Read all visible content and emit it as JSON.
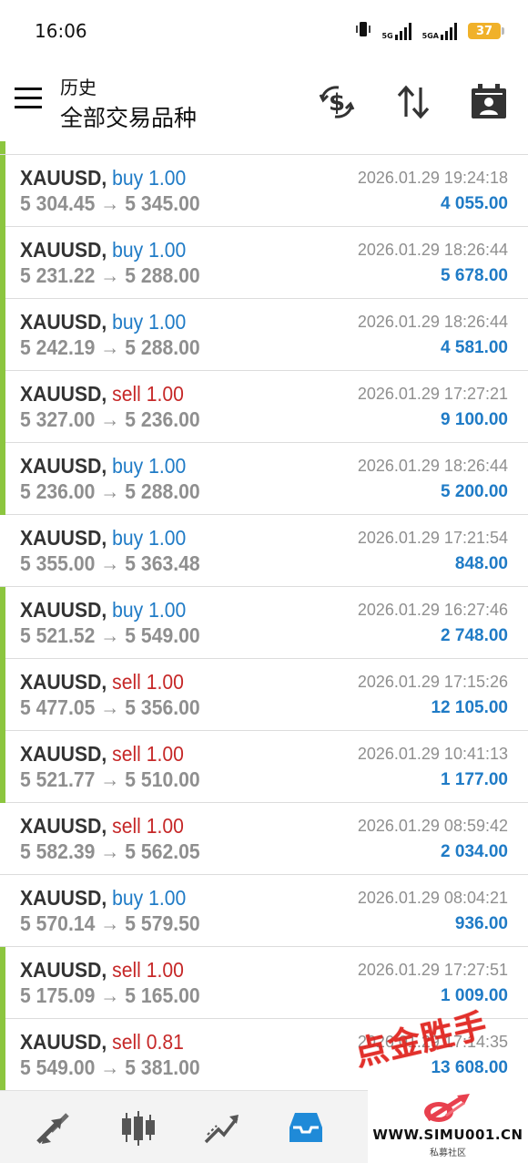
{
  "status_bar": {
    "time": "16:06",
    "network_1": "5G",
    "network_2": "5GA",
    "battery": "37"
  },
  "header": {
    "title": "历史",
    "subtitle": "全部交易品种"
  },
  "trades": [
    {
      "symbol": "XAUUSD",
      "type": "buy 1.00",
      "side": "buy",
      "prices": "5 304.45 → 5 345.00",
      "time": "2026.01.29 19:24:18",
      "profit": "4 055.00",
      "marker": true
    },
    {
      "symbol": "XAUUSD",
      "type": "buy 1.00",
      "side": "buy",
      "prices": "5 231.22 → 5 288.00",
      "time": "2026.01.29 18:26:44",
      "profit": "5 678.00",
      "marker": true
    },
    {
      "symbol": "XAUUSD",
      "type": "buy 1.00",
      "side": "buy",
      "prices": "5 242.19 → 5 288.00",
      "time": "2026.01.29 18:26:44",
      "profit": "4 581.00",
      "marker": true
    },
    {
      "symbol": "XAUUSD",
      "type": "sell 1.00",
      "side": "sell",
      "prices": "5 327.00 → 5 236.00",
      "time": "2026.01.29 17:27:21",
      "profit": "9 100.00",
      "marker": true
    },
    {
      "symbol": "XAUUSD",
      "type": "buy 1.00",
      "side": "buy",
      "prices": "5 236.00 → 5 288.00",
      "time": "2026.01.29 18:26:44",
      "profit": "5 200.00",
      "marker": true
    },
    {
      "symbol": "XAUUSD",
      "type": "buy 1.00",
      "side": "buy",
      "prices": "5 355.00 → 5 363.48",
      "time": "2026.01.29 17:21:54",
      "profit": "848.00",
      "marker": false
    },
    {
      "symbol": "XAUUSD",
      "type": "buy 1.00",
      "side": "buy",
      "prices": "5 521.52 → 5 549.00",
      "time": "2026.01.29 16:27:46",
      "profit": "2 748.00",
      "marker": true
    },
    {
      "symbol": "XAUUSD",
      "type": "sell 1.00",
      "side": "sell",
      "prices": "5 477.05 → 5 356.00",
      "time": "2026.01.29 17:15:26",
      "profit": "12 105.00",
      "marker": true
    },
    {
      "symbol": "XAUUSD",
      "type": "sell 1.00",
      "side": "sell",
      "prices": "5 521.77 → 5 510.00",
      "time": "2026.01.29 10:41:13",
      "profit": "1 177.00",
      "marker": true
    },
    {
      "symbol": "XAUUSD",
      "type": "sell 1.00",
      "side": "sell",
      "prices": "5 582.39 → 5 562.05",
      "time": "2026.01.29 08:59:42",
      "profit": "2 034.00",
      "marker": false
    },
    {
      "symbol": "XAUUSD",
      "type": "buy 1.00",
      "side": "buy",
      "prices": "5 570.14 → 5 579.50",
      "time": "2026.01.29 08:04:21",
      "profit": "936.00",
      "marker": false
    },
    {
      "symbol": "XAUUSD",
      "type": "sell 1.00",
      "side": "sell",
      "prices": "5 175.09 → 5 165.00",
      "time": "2026.01.29 17:27:51",
      "profit": "1 009.00",
      "marker": true
    },
    {
      "symbol": "XAUUSD",
      "type": "sell 0.81",
      "side": "sell",
      "prices": "5 549.00 → 5 381.00",
      "time": "2026.01.29 17:14:35",
      "profit": "13 608.00",
      "marker": true
    }
  ],
  "overlay_stamp": "点金胜手",
  "watermark": {
    "url": "WWW.SIMU001.CN",
    "subtitle": "私募社区"
  },
  "colors": {
    "buy": "#1f7bc6",
    "sell": "#c62828",
    "profit": "#1f7bc6",
    "row_marker": "#8cc63f",
    "active_tab": "#1f8ad8"
  },
  "icons": {
    "header": [
      "menu-icon",
      "currency-exchange-icon",
      "sort-icon",
      "calendar-person-icon"
    ],
    "nav": [
      "quotes-icon",
      "chart-icon",
      "trade-icon",
      "history-icon",
      "messages-icon"
    ]
  }
}
